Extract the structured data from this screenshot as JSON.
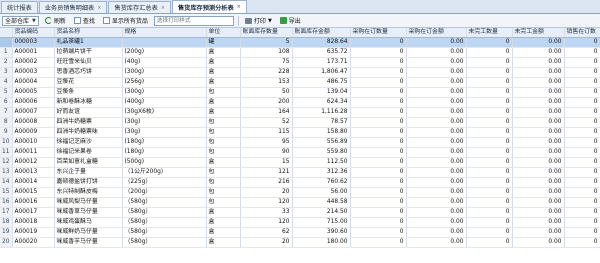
{
  "tabs": [
    {
      "label": "统计报表",
      "active": false
    },
    {
      "label": "业务员销售明细表",
      "active": false
    },
    {
      "label": "售货库存汇总表",
      "active": false
    },
    {
      "label": "售货库存预测分析表",
      "active": true
    }
  ],
  "toolbar": {
    "store_select": "全部仓库",
    "refresh_label": "刷新",
    "find_label": "查找",
    "show_all_label": "显示所有货品",
    "search_placeholder": "选择打印样式",
    "print_label": "打印",
    "export_label": "导出"
  },
  "columns": [
    "",
    "货品编码",
    "货品名称",
    "规格",
    "单位",
    "账面库存数量",
    "账面库存金额",
    "采购在订数量",
    "采购在订金额",
    "未完工数量",
    "未完工金额",
    "销售在订数"
  ],
  "rows": [
    [
      "",
      "000003",
      "礼品茶罐1",
      "",
      "罐",
      "5",
      "828.64",
      "0",
      "0.00",
      "0",
      "0.00",
      "0"
    ],
    [
      "1",
      "A00001",
      "拉萌端片饼干",
      "(200g)",
      "盒",
      "108",
      "635.72",
      "0",
      "0.00",
      "0",
      "0.00",
      "0"
    ],
    [
      "2",
      "A00002",
      "旺旺雪米仙贝",
      "(40g)",
      "盒",
      "75",
      "173.71",
      "0",
      "0.00",
      "0",
      "0.00",
      "0"
    ],
    [
      "3",
      "A00003",
      "思香酒芯巧饼",
      "(300g)",
      "盒",
      "228",
      "1,806.47",
      "0",
      "0.00",
      "0",
      "0.00",
      "0"
    ],
    [
      "4",
      "A00004",
      "豆漿花",
      "(256g)",
      "盒",
      "153",
      "486.75",
      "0",
      "0.00",
      "0",
      "0.00",
      "0"
    ],
    [
      "5",
      "A00005",
      "豆漿条",
      "(300g)",
      "包",
      "50",
      "139.04",
      "0",
      "0.00",
      "0",
      "0.00",
      "0"
    ],
    [
      "6",
      "A00006",
      "新和卷酥冰糖",
      "(400g)",
      "盒",
      "200",
      "624.34",
      "0",
      "0.00",
      "0",
      "0.00",
      "0"
    ],
    [
      "7",
      "A00007",
      "好而友谊",
      "(30gX6枚)",
      "盒",
      "164",
      "1,116.28",
      "0",
      "0.00",
      "0",
      "0.00",
      "0"
    ],
    [
      "8",
      "A00008",
      "四洲牛奶糖票",
      "(30g)",
      "包",
      "52",
      "78.57",
      "0",
      "0.00",
      "0",
      "0.00",
      "0"
    ],
    [
      "9",
      "A00009",
      "四洲牛奶糖票味",
      "(30g)",
      "包",
      "115",
      "158.80",
      "0",
      "0.00",
      "0",
      "0.00",
      "0"
    ],
    [
      "10",
      "A00010",
      "徐福记芝麻沙",
      "(180g)",
      "包",
      "95",
      "556.89",
      "0",
      "0.00",
      "0",
      "0.00",
      "0"
    ],
    [
      "11",
      "A00011",
      "徐福记米果卷",
      "(180g)",
      "包",
      "90",
      "559.80",
      "0",
      "0.00",
      "0",
      "0.00",
      "0"
    ],
    [
      "12",
      "A00012",
      "百荣如意礼盒糖",
      "(500g)",
      "盒",
      "15",
      "112.50",
      "0",
      "0.00",
      "0",
      "0.00",
      "0"
    ],
    [
      "13",
      "A00013",
      "东兴企子量",
      "（1公斤200g）",
      "包",
      "121",
      "312.36",
      "0",
      "0.00",
      "0",
      "0.00",
      "0"
    ],
    [
      "14",
      "A00014",
      "嘉顿德盐饼打饼",
      "（225g）",
      "包",
      "216",
      "760.62",
      "0",
      "0.00",
      "0",
      "0.00",
      "0"
    ],
    [
      "15",
      "A00015",
      "东兴特制酥皮梅",
      "（200g）",
      "包",
      "20",
      "56.00",
      "0",
      "0.00",
      "0",
      "0.00",
      "0"
    ],
    [
      "16",
      "A00016",
      "咪威风梨马仔量",
      "（580g）",
      "包",
      "120",
      "448.58",
      "0",
      "0.00",
      "0",
      "0.00",
      "0"
    ],
    [
      "17",
      "A00017",
      "咪威香草马仔量",
      "（580g）",
      "盒",
      "33",
      "214.50",
      "0",
      "0.00",
      "0",
      "0.00",
      "0"
    ],
    [
      "18",
      "A00018",
      "咪威鸡蛋酥马",
      "（580g）",
      "盒",
      "120",
      "715.00",
      "0",
      "0.00",
      "0",
      "0.00",
      "0"
    ],
    [
      "19",
      "A00019",
      "咪威鲜奶马仔量",
      "（580g）",
      "盒",
      "62",
      "390.60",
      "0",
      "0.00",
      "0",
      "0.00",
      "0"
    ],
    [
      "20",
      "A00020",
      "咪威香芋马仔量",
      "（580g）",
      "盒",
      "20",
      "180.00",
      "0",
      "0.00",
      "0",
      "0.00",
      "0"
    ]
  ],
  "colors": {
    "selected_row": "#bcd6f3",
    "header_bg": "#e7eef7"
  }
}
